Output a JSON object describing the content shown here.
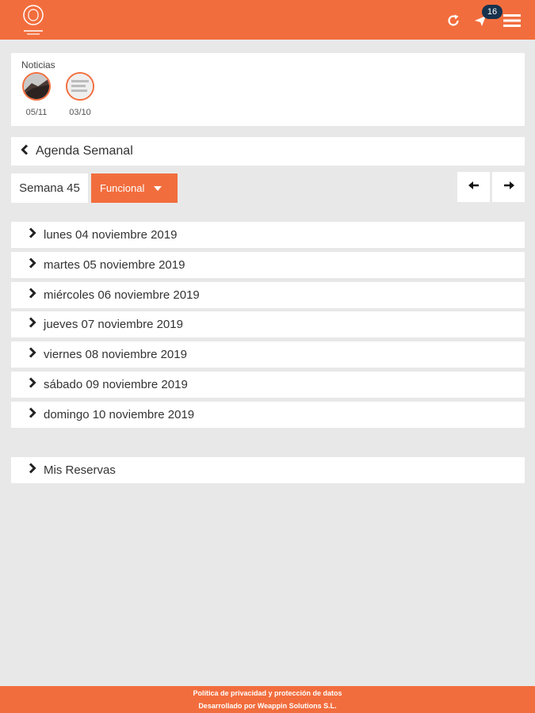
{
  "header": {
    "logo_icon": "brand-logo-icon",
    "notification_count": "16",
    "accent": "#f26d3d",
    "badge_color": "#17324d"
  },
  "news": {
    "title": "Noticias",
    "items": [
      {
        "date": "05/11"
      },
      {
        "date": "03/10"
      }
    ]
  },
  "agenda": {
    "title": "Agenda Semanal"
  },
  "week": {
    "label": "Semana 45",
    "filter": "Funcional"
  },
  "days": [
    "lunes 04 noviembre 2019",
    "martes 05 noviembre 2019",
    "miércoles 06 noviembre 2019",
    "jueves 07 noviembre 2019",
    "viernes 08 noviembre 2019",
    "sábado 09 noviembre 2019",
    "domingo 10 noviembre 2019"
  ],
  "reservations": {
    "label": "Mis Reservas"
  },
  "footer": {
    "privacy": "Política de privacidad y protección de datos",
    "developer": "Desarrollado por Weappin Solutions S.L."
  }
}
